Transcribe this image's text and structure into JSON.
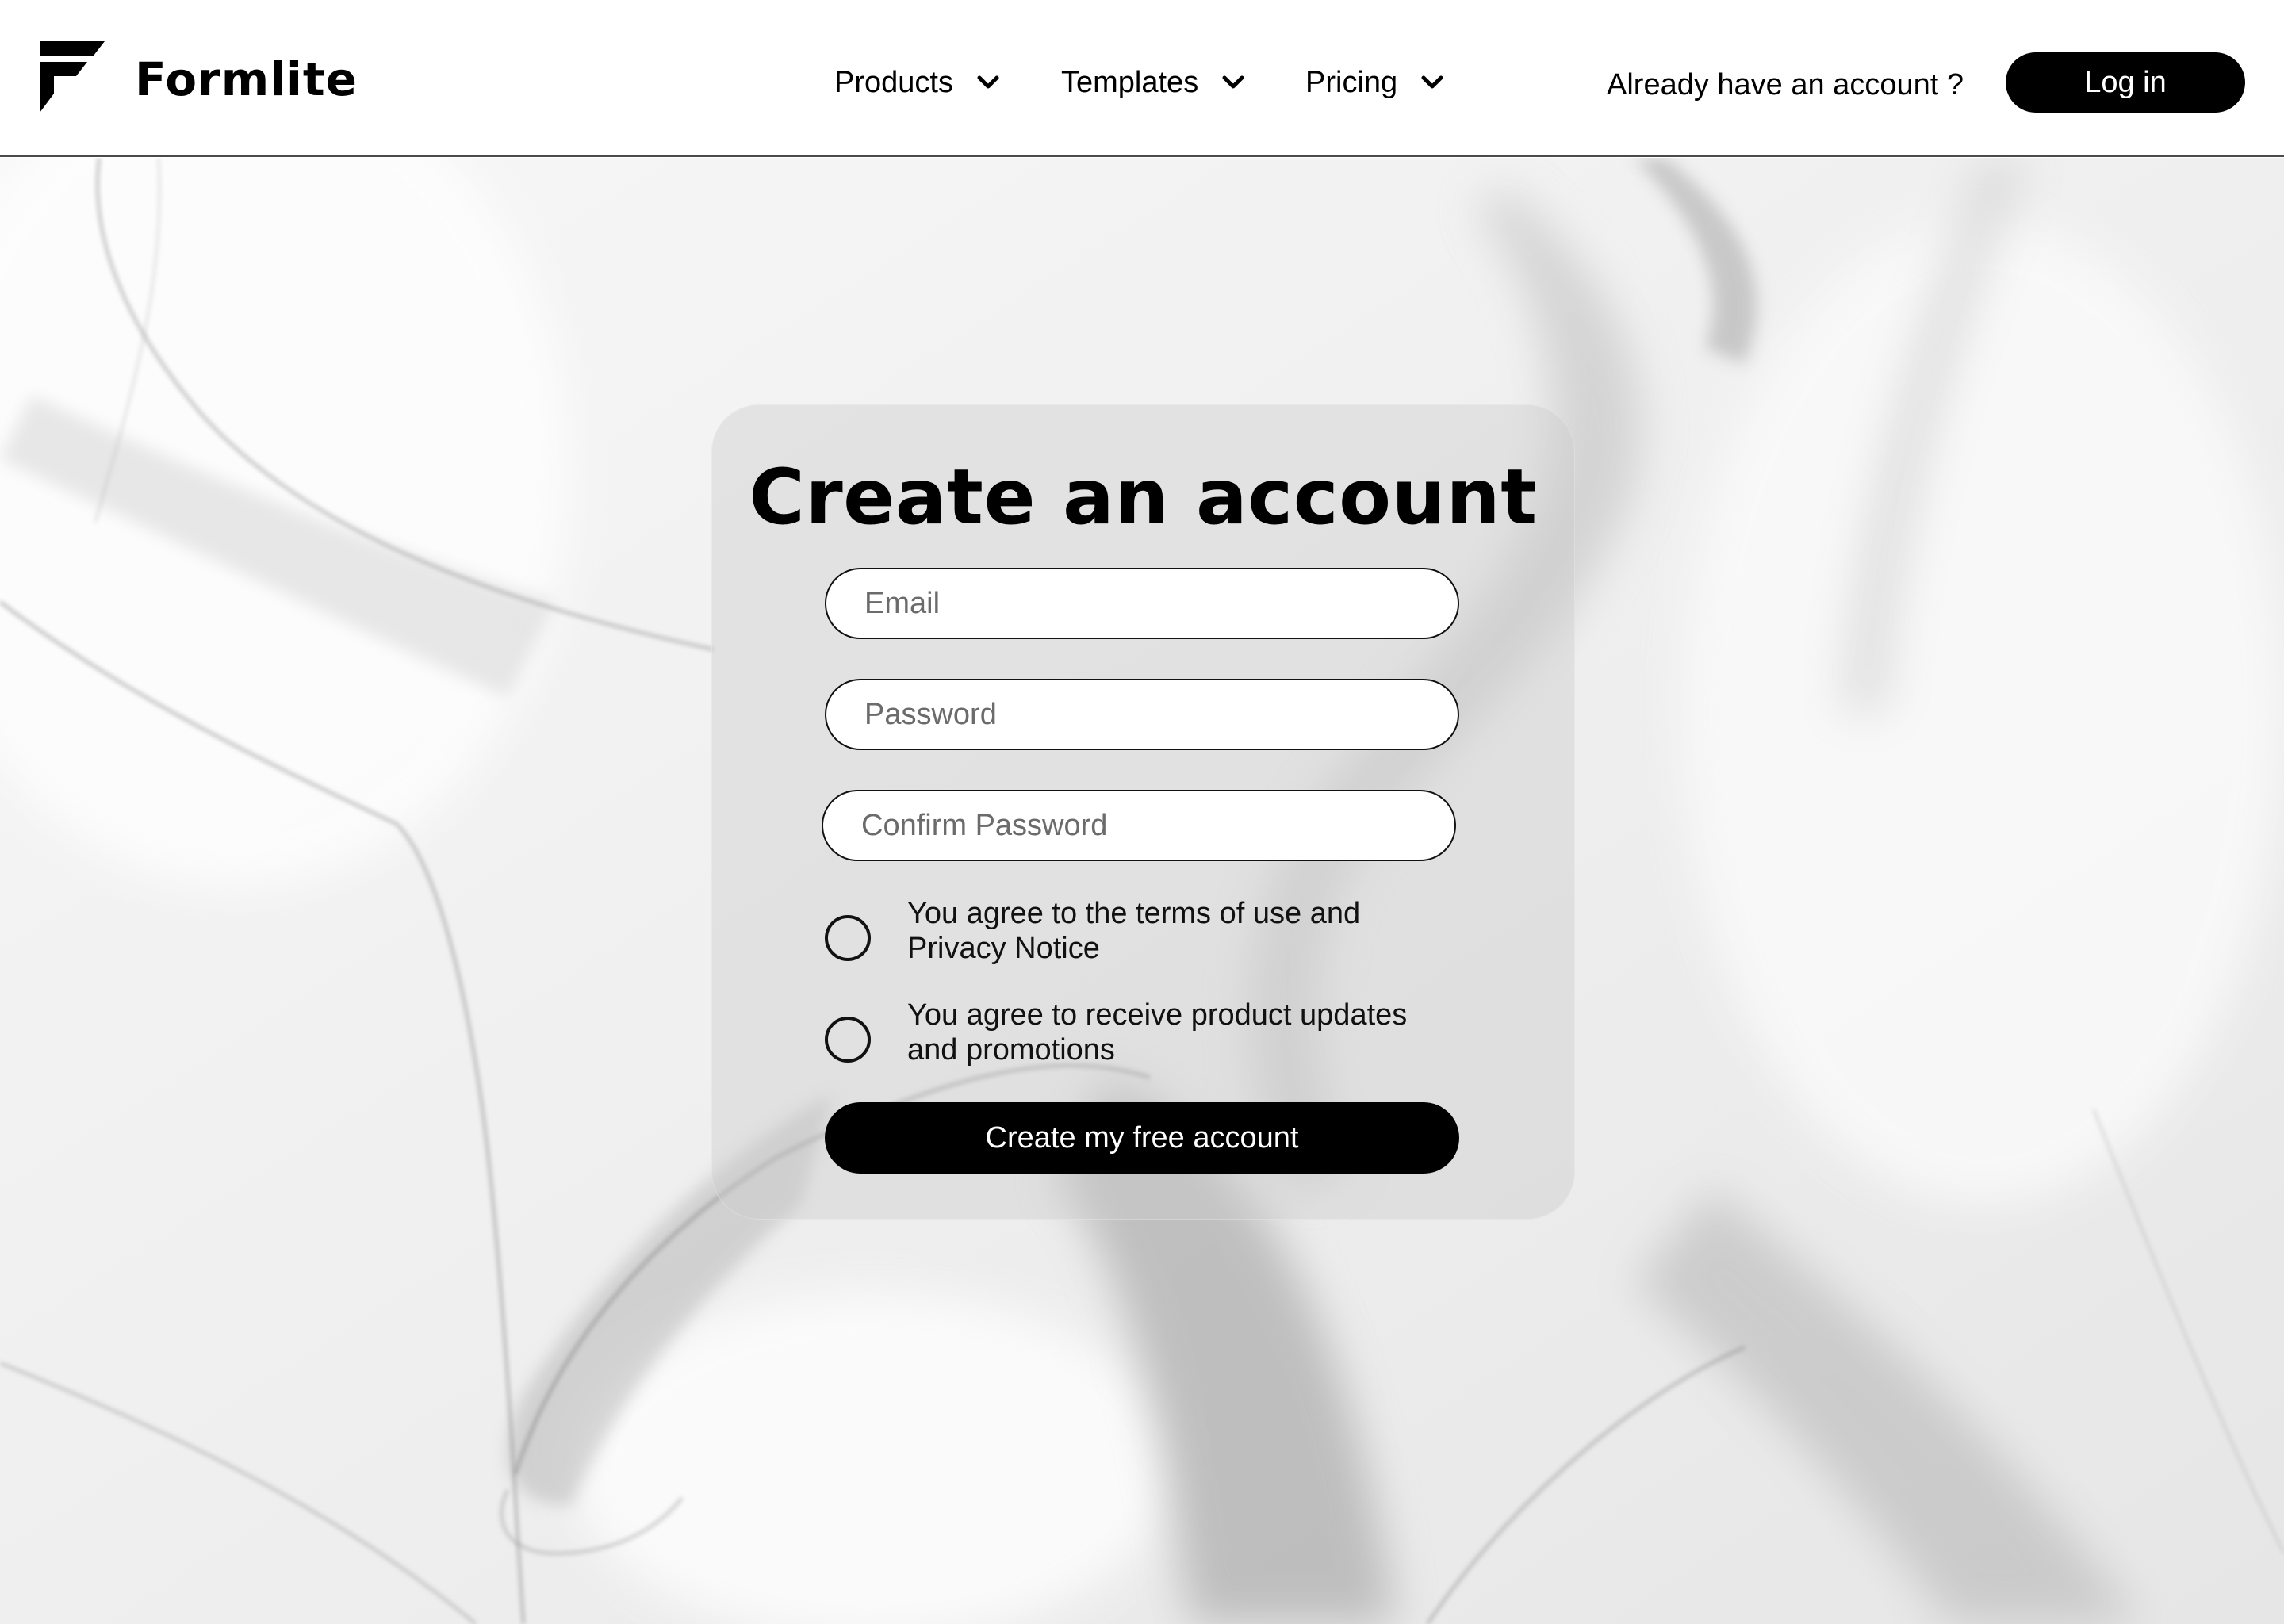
{
  "header": {
    "brand": "Formlite",
    "nav": [
      {
        "label": "Products",
        "icon": "chevron-down-icon"
      },
      {
        "label": "Templates",
        "icon": "chevron-down-icon"
      },
      {
        "label": "Pricing",
        "icon": "chevron-down-icon"
      }
    ],
    "already_text": "Already have an account ?",
    "login_label": "Log in"
  },
  "form": {
    "title": "Create an account",
    "email_placeholder": "Email",
    "password_placeholder": "Password",
    "confirm_placeholder": "Confirm Password",
    "consents": [
      {
        "label": "You agree to the terms of use and Privacy Notice",
        "checked": false
      },
      {
        "label": "You agree to receive product updates and promotions",
        "checked": false
      }
    ],
    "submit_label": "Create my free account"
  },
  "colors": {
    "primary": "#000000",
    "surface": "#ffffff",
    "card_tint": "#cecece"
  },
  "icons": {
    "logo": "formlite-logo-icon",
    "nav_chevron": "chevron-down-icon",
    "consent": "radio-circle-icon"
  }
}
